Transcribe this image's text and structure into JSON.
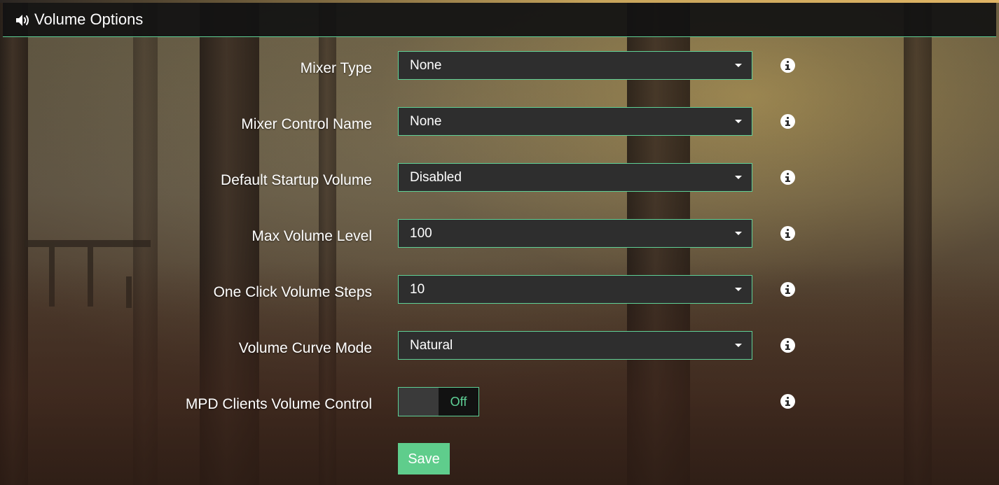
{
  "header": {
    "title": "Volume Options",
    "icon": "volume-icon"
  },
  "rows": [
    {
      "label": "Mixer Type",
      "value": "None",
      "type": "select"
    },
    {
      "label": "Mixer Control Name",
      "value": "None",
      "type": "select"
    },
    {
      "label": "Default Startup Volume",
      "value": "Disabled",
      "type": "select"
    },
    {
      "label": "Max Volume Level",
      "value": "100",
      "type": "select"
    },
    {
      "label": "One Click Volume Steps",
      "value": "10",
      "type": "select"
    },
    {
      "label": "Volume Curve Mode",
      "value": "Natural",
      "type": "select"
    },
    {
      "label": "MPD Clients Volume Control",
      "value": "Off",
      "type": "toggle"
    }
  ],
  "save_label": "Save",
  "colors": {
    "accent": "#5fd197",
    "button": "#5fcd8c",
    "field_bg": "#2e2e2e",
    "header_bg": "#121212"
  }
}
